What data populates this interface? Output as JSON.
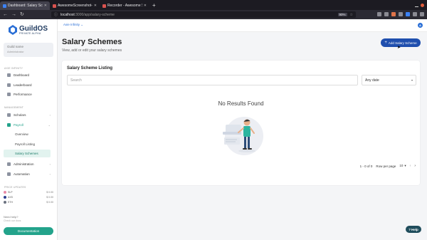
{
  "browser": {
    "tabs": [
      {
        "label": "Dashboard: Salary Schemes",
        "active": true
      },
      {
        "label": "AwesomeScreenshot-10/"
      },
      {
        "label": "Recorder - Awesome Sc..."
      }
    ],
    "url_host": "localhost",
    "url_path": ":3000/app/salary-scheme",
    "zoom": "90%"
  },
  "sidebar": {
    "logo_text": "GuildOS",
    "logo_sub": "PRIVATE ALPHA",
    "guild_name": "Guild name",
    "guild_role": "Administrator",
    "section_guild": "AXIE INFINITY",
    "guild_items": [
      {
        "label": "Dashboard"
      },
      {
        "label": "Leaderboard"
      },
      {
        "label": "Performance"
      }
    ],
    "section_management": "MANAGEMENT",
    "scholars": "Scholars",
    "payroll": "Payroll",
    "payroll_sub": [
      {
        "label": "Overview"
      },
      {
        "label": "Payroll Listing"
      },
      {
        "label": "Salary Schemes"
      }
    ],
    "administration": "Administration",
    "automation": "Automation",
    "section_prices": "PRICE UPDATES",
    "prices": [
      {
        "coin": "SLP",
        "value": "$ 0.00"
      },
      {
        "coin": "AXS",
        "value": "$ 0.00"
      },
      {
        "coin": "ETH",
        "value": "$ 0.00"
      }
    ],
    "help_question": "Need help?",
    "help_sub": "Check our docs",
    "doc_button": "Documentation"
  },
  "header": {
    "guild_select": "Axie Infinity",
    "avatar_initial": "A"
  },
  "main": {
    "title": "Salary Schemes",
    "subtitle": "View, add or edit your salary schemes",
    "add_button": "Add Salary Scheme",
    "card_title": "Salary Scheme Listing",
    "search_placeholder": "Search",
    "date_filter": "Any date",
    "empty_text": "No Results Found",
    "pagination_range": "1 - 0 of 0",
    "rows_per_page_label": "Row per page",
    "rows_per_page_value": "10"
  },
  "help_button": "Help",
  "colors": {
    "accent_green": "#23a38b",
    "primary_blue": "#1f4fae"
  }
}
